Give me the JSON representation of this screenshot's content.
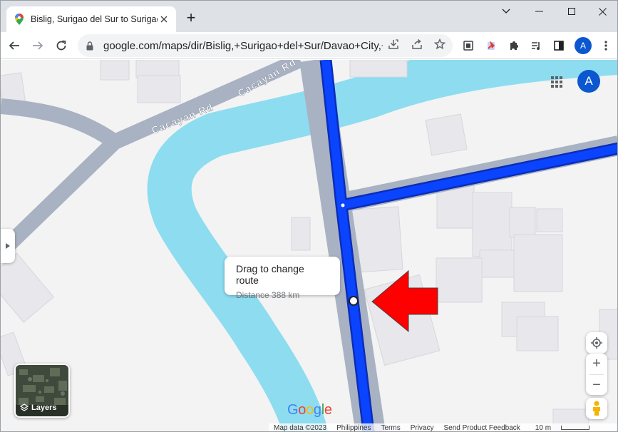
{
  "browser": {
    "tab_title": "Bislig, Surigao del Sur to Surigao",
    "new_tab_symbol": "+",
    "url": "google.com/maps/dir/Bislig,+Surigao+del+Sur/Davao+City,+...",
    "profile_initial": "A"
  },
  "map": {
    "road_labels": [
      "Cacayan Rd",
      "Cacayan Rd"
    ],
    "profile_initial": "A",
    "tooltip": {
      "title": "Drag to change route",
      "distance": "Distance 388 km"
    },
    "layers_label": "Layers",
    "zoom_in_symbol": "+",
    "zoom_out_symbol": "−",
    "google_logo": [
      "G",
      "o",
      "o",
      "g",
      "l",
      "e"
    ],
    "footer": {
      "map_data": "Map data ©2023",
      "country": "Philippines",
      "terms": "Terms",
      "privacy": "Privacy",
      "feedback": "Send Product Feedback",
      "scale": "10 m"
    }
  },
  "colors": {
    "route": "#0a44ff",
    "route_outline": "#0b2db8",
    "road": "#a8b2c2",
    "water": "#8ddcf0",
    "building": "#e8e8ec",
    "annotation_arrow": "#ff0000",
    "accent": "#0b57d0"
  },
  "icons": [
    "maps-favicon",
    "close-icon",
    "back-arrow-icon",
    "forward-arrow-icon",
    "reload-icon",
    "lock-icon",
    "install-icon",
    "share-icon",
    "star-icon",
    "screenshot-icon",
    "extension-red-icon",
    "puzzle-icon",
    "media-icon",
    "sidepanel-icon",
    "kebab-menu-icon",
    "apps-grid-icon",
    "location-icon",
    "pegman-icon",
    "layers-icon"
  ]
}
